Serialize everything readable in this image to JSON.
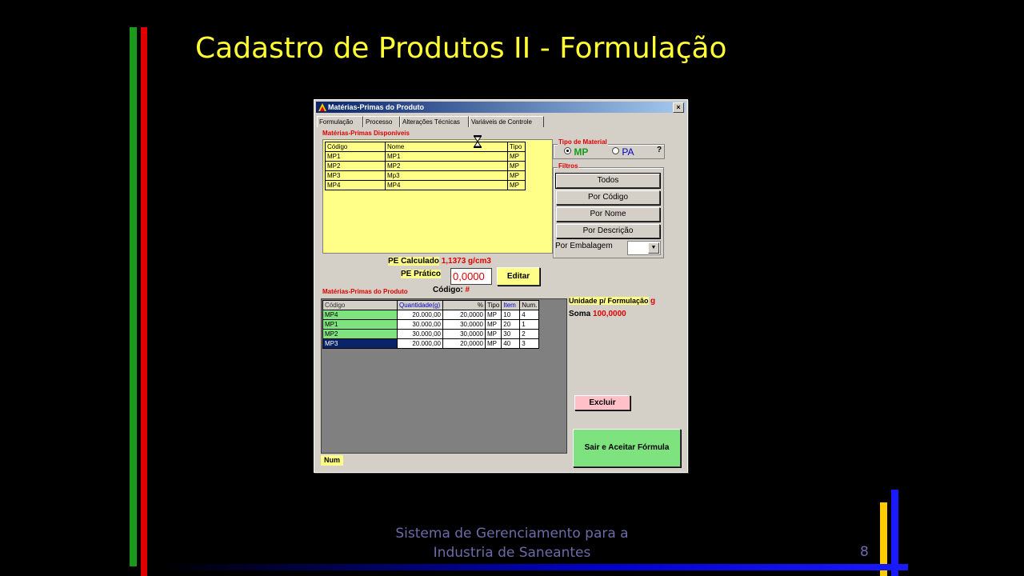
{
  "slide": {
    "title": "Cadastro de Produtos II - Formulação",
    "footer_line1": "Sistema de Gerenciamento para a",
    "footer_line2": "Industria de Saneantes",
    "page_number": "8"
  },
  "window": {
    "title": "Matérias-Primas do Produto",
    "close_glyph": "×",
    "tabs": [
      "Formulação",
      "Processo",
      "Alterações Técnicas",
      "Variáveis de Controle"
    ]
  },
  "available": {
    "label": "Matérias-Primas Disponíveis",
    "columns": [
      "Código",
      "Nome",
      "Tipo"
    ],
    "rows": [
      [
        "MP1",
        "MP1",
        "MP"
      ],
      [
        "MP2",
        "MP2",
        "MP"
      ],
      [
        "MP3",
        "Mp3",
        "MP"
      ],
      [
        "MP4",
        "MP4",
        "MP"
      ]
    ]
  },
  "material_type": {
    "label": "Tipo de Material",
    "option_mp": "MP",
    "option_pa": "PA",
    "help": "?"
  },
  "filters": {
    "label": "Filtros",
    "all": "Todos",
    "by_code": "Por Código",
    "by_name": "Por Nome",
    "by_description": "Por Descrição",
    "by_package": "Por Embalagem"
  },
  "pe": {
    "calc_label": "PE Calculado",
    "calc_value": "1,1373 g/cm3",
    "practical_label": "PE Prático",
    "practical_value": "0,0000",
    "edit_button": "Editar"
  },
  "product": {
    "label": "Matérias-Primas do Produto",
    "code_label": "Código:",
    "code_value": "#",
    "columns": [
      "Código",
      "Quantidade(g)",
      "%",
      "Tipo",
      "Item",
      "Num."
    ],
    "rows": [
      [
        "MP4",
        "20.000,00",
        "20,0000",
        "MP",
        "10",
        "4"
      ],
      [
        "MP1",
        "30.000,00",
        "30,0000",
        "MP",
        "20",
        "1"
      ],
      [
        "MP2",
        "30.000,00",
        "30,0000",
        "MP",
        "30",
        "2"
      ],
      [
        "MP3",
        "20.000,00",
        "20,0000",
        "MP",
        "40",
        "3"
      ]
    ],
    "unit_label": "Unidade p/ Formulação",
    "unit_value": "g",
    "sum_label": "Soma",
    "sum_value": "100,0000"
  },
  "actions": {
    "delete": "Excluir",
    "accept": "Sair e Aceitar Fórmula"
  },
  "status": {
    "num": "Num"
  },
  "colors": {
    "slide_title": "#ffff33",
    "grid_yellow": "#ffff88",
    "row_green": "#7ee27e",
    "label_red": "#e00000"
  }
}
